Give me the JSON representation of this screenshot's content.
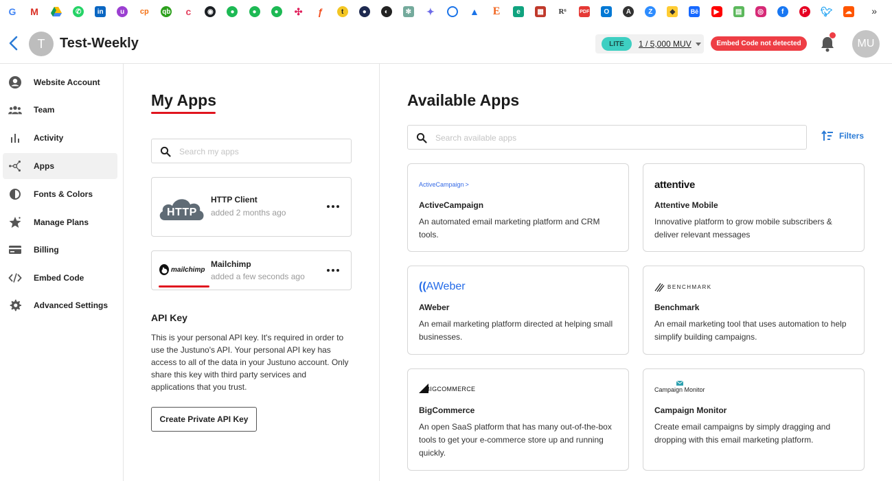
{
  "bookmarks": [
    "google-icon",
    "gmail-icon",
    "drive-icon",
    "whatsapp-icon",
    "linkedin-icon",
    "app-icon",
    "app-icon",
    "app-icon",
    "app-icon",
    "github-icon",
    "app-icon",
    "app-icon",
    "app-icon",
    "app-icon",
    "figma-icon",
    "app-icon",
    "app-icon",
    "app-icon",
    "chatgpt-icon",
    "gemini-icon",
    "app-icon",
    "app-icon",
    "app-icon",
    "app-icon",
    "app-icon",
    "app-icon",
    "app-icon",
    "app-icon",
    "outlook-icon",
    "app-icon",
    "app-icon",
    "app-icon",
    "behance-icon",
    "youtube-icon",
    "app-icon",
    "instagram-icon",
    "facebook-icon",
    "pinterest-icon",
    "twitter-icon",
    "soundcloud-icon"
  ],
  "bookmarks_more": "»",
  "header": {
    "site_initial": "T",
    "site_title": "Test-Weekly",
    "plan_tier": "LITE",
    "plan_usage": "1 / 5,000 MUV",
    "embed_status": "Embed Code not detected",
    "user_initials": "MU"
  },
  "sidebar": {
    "items": [
      {
        "label": "Website Account",
        "icon": "user-circle-icon"
      },
      {
        "label": "Team",
        "icon": "team-icon"
      },
      {
        "label": "Activity",
        "icon": "bar-chart-icon"
      },
      {
        "label": "Apps",
        "icon": "apps-network-icon"
      },
      {
        "label": "Fonts & Colors",
        "icon": "contrast-icon"
      },
      {
        "label": "Manage Plans",
        "icon": "star-icon"
      },
      {
        "label": "Billing",
        "icon": "credit-card-icon"
      },
      {
        "label": "Embed Code",
        "icon": "code-icon"
      },
      {
        "label": "Advanced Settings",
        "icon": "gear-icon"
      }
    ],
    "active": "Apps"
  },
  "my_apps": {
    "heading": "My Apps",
    "search_placeholder": "Search my apps",
    "apps": [
      {
        "name": "HTTP Client",
        "added": "added 2 months ago",
        "logo_text": "HTTP"
      },
      {
        "name": "Mailchimp",
        "added": "added a few seconds ago",
        "logo_text": "mailchimp"
      }
    ],
    "api_title": "API Key",
    "api_desc": "This is your personal API key. It's required in order to use the Justuno's API. Your personal API key has access to all of the data in your Justuno account. Only share this key with third party services and applications that you trust.",
    "api_button": "Create Private API Key"
  },
  "available_apps": {
    "heading": "Available Apps",
    "search_placeholder": "Search available apps",
    "filters_label": "Filters",
    "apps": [
      {
        "name": "ActiveCampaign",
        "logo_text": "ActiveCampaign",
        "desc": "An automated email marketing platform and CRM tools."
      },
      {
        "name": "Attentive Mobile",
        "logo_text": "attentive",
        "desc": "Innovative platform to grow mobile subscribers & deliver relevant messages"
      },
      {
        "name": "AWeber",
        "logo_text": "AWeber",
        "desc": "An email marketing platform directed at helping small businesses."
      },
      {
        "name": "Benchmark",
        "logo_text": "BENCHMARK",
        "desc": "An email marketing tool that uses automation to help simplify building campaigns."
      },
      {
        "name": "BigCommerce",
        "logo_text": "BIGCOMMERCE",
        "desc": "An open SaaS platform that has many out-of-the-box tools to get your e-commerce store up and running quickly."
      },
      {
        "name": "Campaign Monitor",
        "logo_text": "Campaign Monitor",
        "desc": "Create email campaigns by simply dragging and dropping with this email marketing platform."
      }
    ]
  },
  "colors": {
    "accent_red": "#e0141e",
    "link_blue": "#2b7bd6",
    "lite_teal": "#3ecfc2",
    "badge_red": "#ee3e45"
  }
}
